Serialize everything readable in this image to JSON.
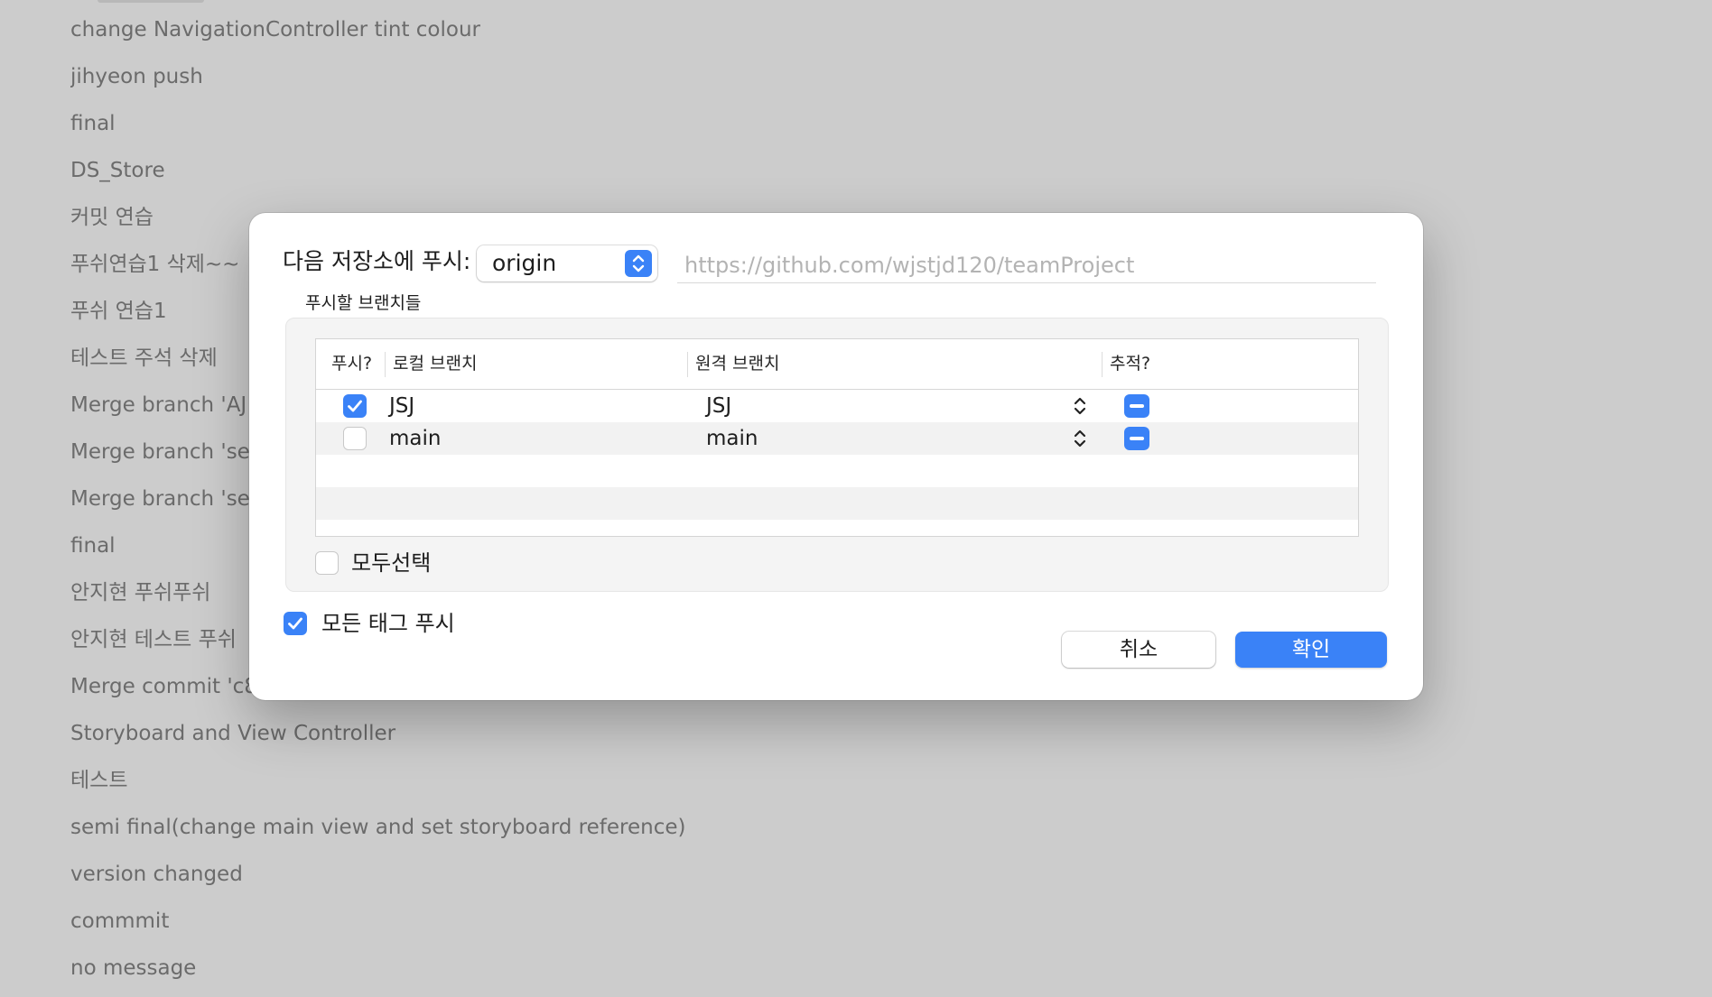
{
  "commit_list": [
    "change NavigationController tint colour",
    "jihyeon push",
    "final",
    "DS_Store",
    "커밋 연습",
    "푸쉬연습1 삭제~~",
    "푸쉬 연습1",
    "테스트 주석 삭제",
    "Merge branch 'AJ",
    "Merge branch 'se",
    "Merge branch 'se",
    "final",
    "안지현 푸쉬푸쉬",
    "안지현 테스트 푸쉬",
    "Merge commit 'c8",
    "Storyboard and View Controller",
    "테스트",
    "semi final(change main view and set storyboard reference)",
    "version changed",
    "commmit",
    "no message"
  ],
  "dialog": {
    "push_to_label": "다음 저장소에 푸시:",
    "remote_name": "origin",
    "remote_url": "https://github.com/wjstjd120/teamProject",
    "branches_label": "푸시할 브랜치들",
    "columns": {
      "push": "푸시?",
      "local": "로컬 브랜치",
      "remote": "원격 브랜치",
      "track": "추적?"
    },
    "rows": [
      {
        "push": true,
        "local": "JSJ",
        "remote": "JSJ"
      },
      {
        "push": false,
        "local": "main",
        "remote": "main"
      }
    ],
    "select_all_label": "모두선택",
    "select_all_checked": false,
    "push_all_tags_label": "모든 태그 푸시",
    "push_all_tags_checked": true,
    "cancel_label": "취소",
    "ok_label": "확인"
  },
  "colors": {
    "accent": "#3a82f7",
    "backdrop": "#cccccc"
  }
}
